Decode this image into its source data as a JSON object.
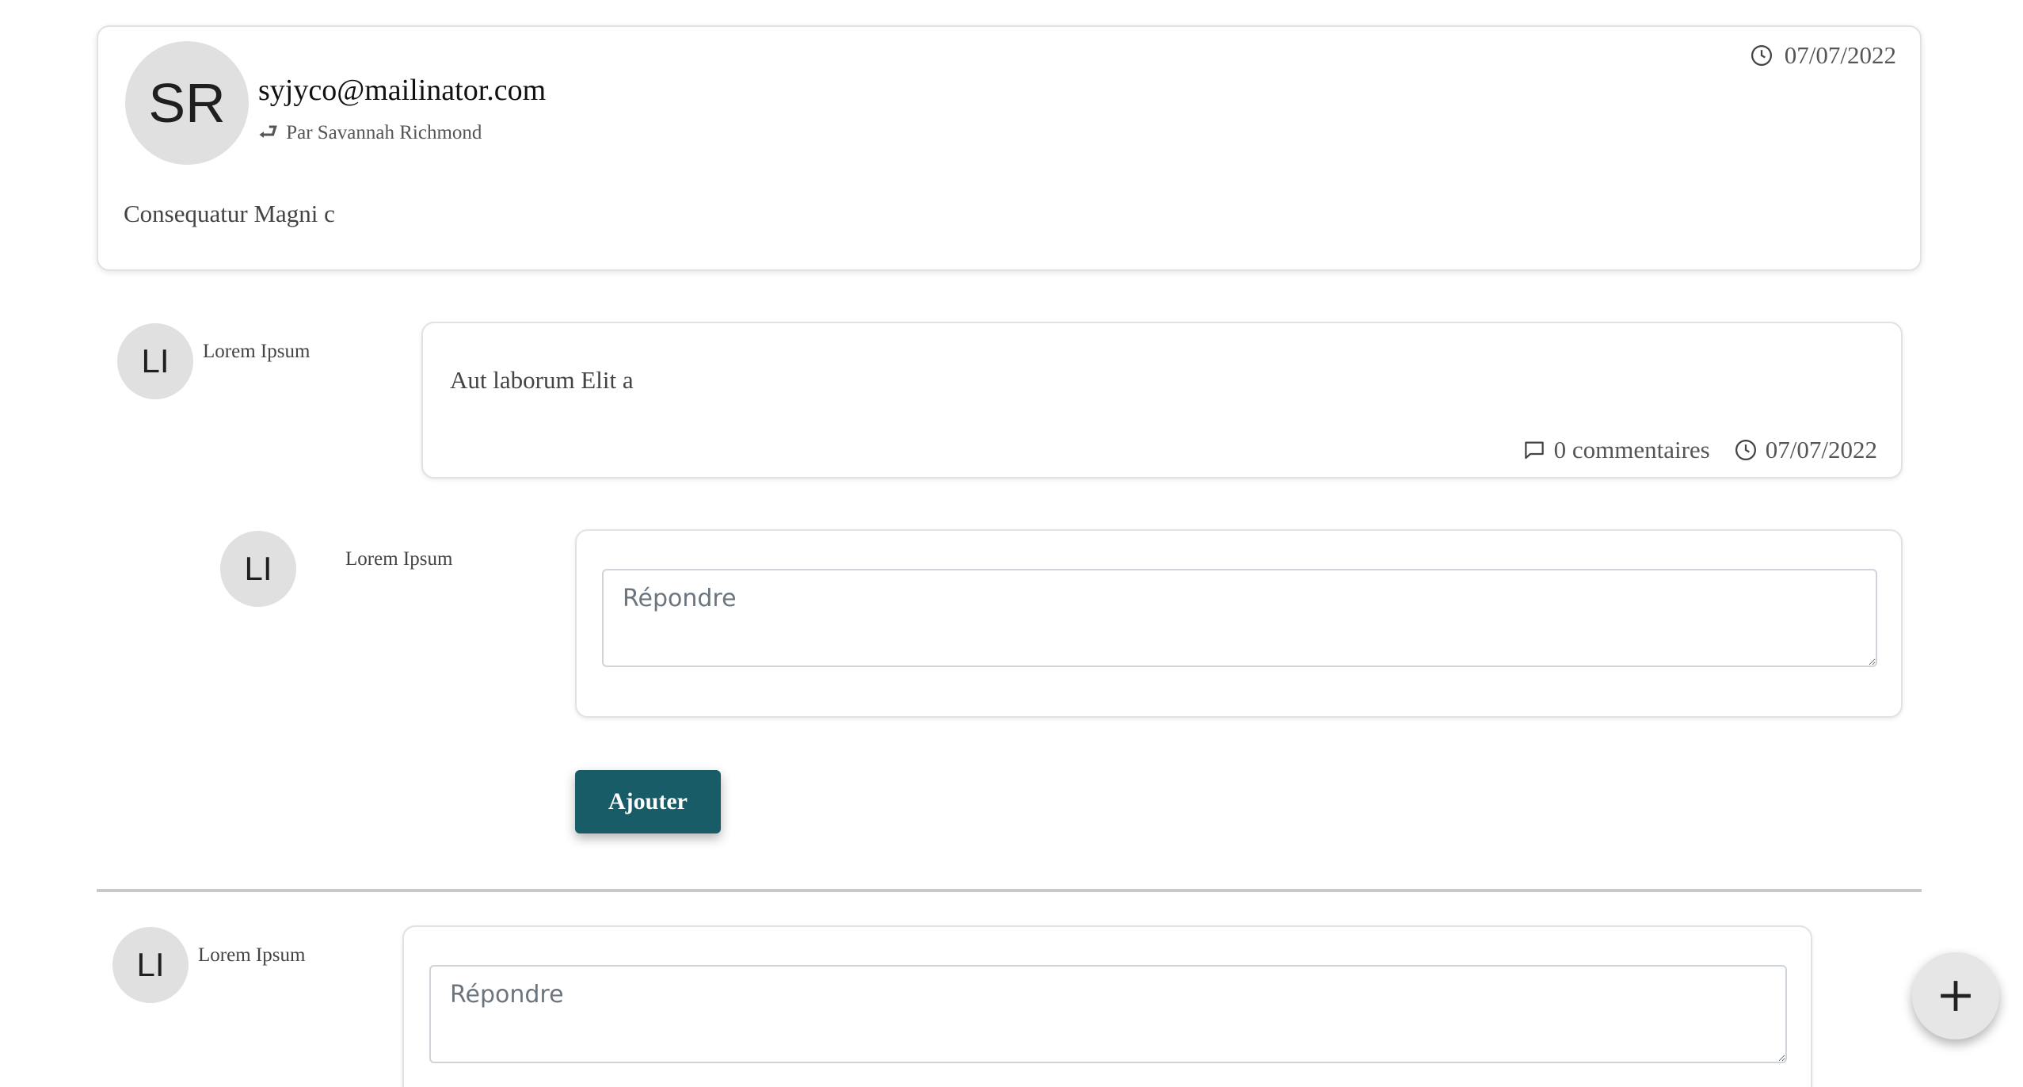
{
  "main_message": {
    "avatar_initials": "SR",
    "sender": "syjyco@mailinator.com",
    "byline": "Par Savannah Richmond",
    "body": "Consequatur Magni c",
    "date": "07/07/2022"
  },
  "reply": {
    "avatar_initials": "LI",
    "author": "Lorem Ipsum",
    "text": "Aut laborum Elit a",
    "comments_label": "0 commentaires",
    "date": "07/07/2022"
  },
  "reply_form": {
    "avatar_initials": "LI",
    "author": "Lorem Ipsum",
    "placeholder": "Répondre",
    "value": "",
    "submit_label": "Ajouter"
  },
  "new_reply_form": {
    "avatar_initials": "LI",
    "author": "Lorem Ipsum",
    "placeholder": "Répondre",
    "value": ""
  },
  "fab": {
    "icon": "plus-icon"
  },
  "colors": {
    "button_bg": "#175c66",
    "avatar_bg": "#e0e0e0",
    "card_border": "#e2e2e2"
  }
}
